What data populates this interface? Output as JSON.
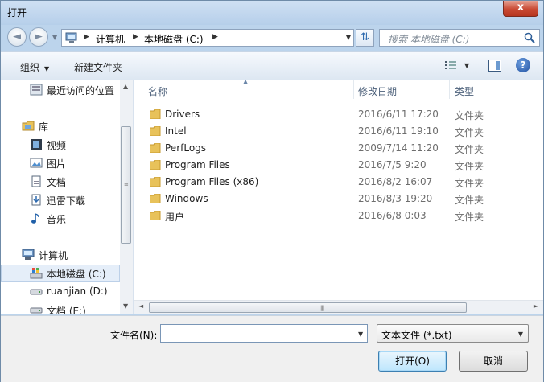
{
  "window": {
    "title": "打开",
    "close_glyph": "x"
  },
  "nav": {
    "back_glyph": "◄",
    "forward_glyph": "►",
    "breadcrumb": [
      "计算机",
      "本地磁盘 (C:)"
    ],
    "refresh_glyph": "⇅",
    "search_placeholder": "搜索 本地磁盘 (C:)"
  },
  "toolbar": {
    "organize": "组织",
    "new_folder": "新建文件夹",
    "help": "?"
  },
  "sidebar": {
    "items": [
      {
        "label": "最近访问的位置",
        "icon": "recent-places-icon"
      },
      {
        "label": "库",
        "icon": "libraries-icon"
      },
      {
        "label": "视频",
        "icon": "videos-icon"
      },
      {
        "label": "图片",
        "icon": "pictures-icon"
      },
      {
        "label": "文档",
        "icon": "documents-icon"
      },
      {
        "label": "迅雷下载",
        "icon": "download-icon"
      },
      {
        "label": "音乐",
        "icon": "music-icon"
      },
      {
        "label": "计算机",
        "icon": "computer-icon"
      },
      {
        "label": "本地磁盘 (C:)",
        "icon": "system-drive-icon",
        "selected": true
      },
      {
        "label": "ruanjian (D:)",
        "icon": "drive-icon"
      },
      {
        "label": "文档 (E:)",
        "icon": "drive-icon"
      }
    ]
  },
  "files": {
    "columns": {
      "name": "名称",
      "date": "修改日期",
      "type": "类型"
    },
    "rows": [
      {
        "name": "Drivers",
        "date": "2016/6/11 17:20",
        "type": "文件夹"
      },
      {
        "name": "Intel",
        "date": "2016/6/11 19:10",
        "type": "文件夹"
      },
      {
        "name": "PerfLogs",
        "date": "2009/7/14 11:20",
        "type": "文件夹"
      },
      {
        "name": "Program Files",
        "date": "2016/7/5 9:20",
        "type": "文件夹"
      },
      {
        "name": "Program Files (x86)",
        "date": "2016/8/2 16:07",
        "type": "文件夹"
      },
      {
        "name": "Windows",
        "date": "2016/8/3 19:20",
        "type": "文件夹"
      },
      {
        "name": "用户",
        "date": "2016/6/8 0:03",
        "type": "文件夹"
      }
    ]
  },
  "footer": {
    "filename_label": "文件名(N):",
    "filename_value": "",
    "filter_value": "文本文件 (*.txt)",
    "open_button": "打开(O)",
    "cancel_button": "取消"
  },
  "colors": {
    "accent": "#3c7fb1",
    "folder": "#e8c25a",
    "selection": "#e5eef9"
  }
}
